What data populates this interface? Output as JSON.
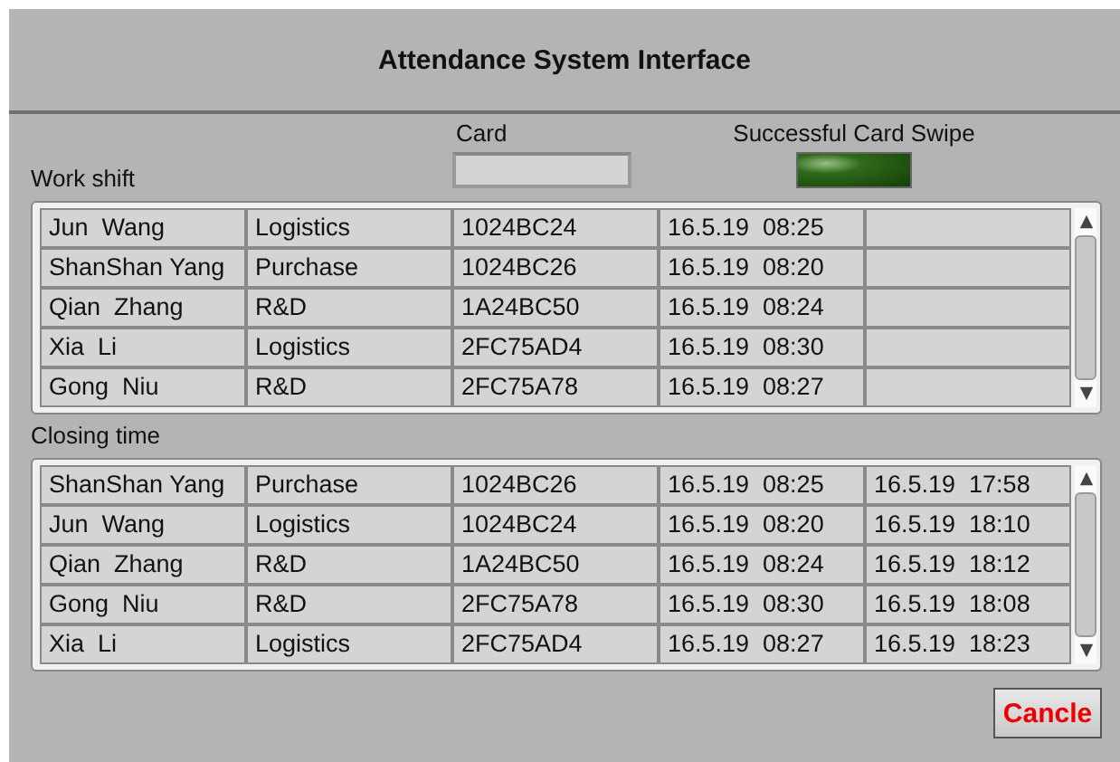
{
  "window": {
    "title": "Attendance System Interface"
  },
  "card": {
    "label": "Card"
  },
  "swipe_indicator": {
    "label": "Successful Card Swipe",
    "on": true
  },
  "work_shift": {
    "label": "Work shift",
    "rows": [
      [
        "Jun  Wang",
        "Logistics",
        "1024BC24",
        "16.5.19  08:25"
      ],
      [
        "ShanShan Yang",
        "Purchase",
        "1024BC26",
        "16.5.19  08:20"
      ],
      [
        "Qian  Zhang",
        "R&D",
        "1A24BC50",
        "16.5.19  08:24"
      ],
      [
        "Xia  Li",
        "Logistics",
        "2FC75AD4",
        "16.5.19  08:30"
      ],
      [
        "Gong  Niu",
        "R&D",
        "2FC75A78",
        "16.5.19  08:27"
      ]
    ]
  },
  "closing_time": {
    "label": "Closing time",
    "rows": [
      [
        "ShanShan Yang",
        "Purchase",
        "1024BC26",
        "16.5.19  08:25",
        "16.5.19  17:58"
      ],
      [
        "Jun  Wang",
        "Logistics",
        "1024BC24",
        "16.5.19  08:20",
        "16.5.19  18:10"
      ],
      [
        "Qian  Zhang",
        "R&D",
        "1A24BC50",
        "16.5.19  08:24",
        "16.5.19  18:12"
      ],
      [
        "Gong  Niu",
        "R&D",
        "2FC75A78",
        "16.5.19  08:30",
        "16.5.19  18:08"
      ],
      [
        "Xia  Li",
        "Logistics",
        "2FC75AD4",
        "16.5.19  08:27",
        "16.5.19  18:23"
      ]
    ]
  },
  "buttons": [
    {
      "label": "Cancle"
    }
  ]
}
